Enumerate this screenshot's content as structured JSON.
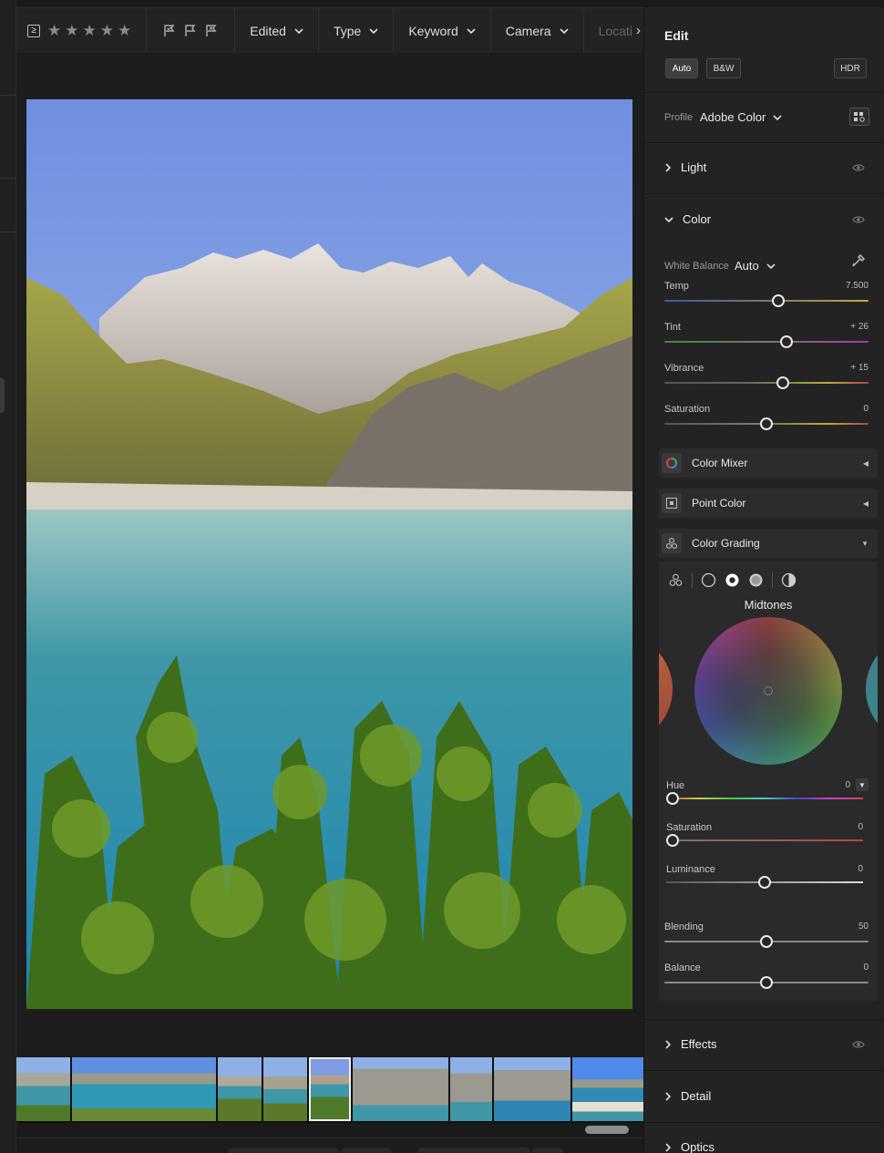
{
  "toolbar": {
    "ge_symbol": "≥",
    "stars": [
      "★",
      "★",
      "★",
      "★",
      "★"
    ],
    "filters": [
      {
        "label": "Edited"
      },
      {
        "label": "Type"
      },
      {
        "label": "Keyword"
      },
      {
        "label": "Camera"
      }
    ],
    "truncated_filter": "Locati",
    "more_arrow": "›"
  },
  "panel": {
    "title": "Edit",
    "auto_label": "Auto",
    "bw_label": "B&W",
    "hdr_label": "HDR",
    "profile_label": "Profile",
    "profile_value": "Adobe Color",
    "sections": {
      "light": "Light",
      "color": "Color",
      "effects": "Effects",
      "detail": "Detail",
      "optics": "Optics"
    },
    "white_balance_label": "White Balance",
    "white_balance_value": "Auto",
    "color_sliders": [
      {
        "label": "Temp",
        "value": "7.500",
        "position": 0.56
      },
      {
        "label": "Tint",
        "value": "+ 26",
        "position": 0.6
      },
      {
        "label": "Vibrance",
        "value": "+ 15",
        "position": 0.58
      },
      {
        "label": "Saturation",
        "value": "0",
        "position": 0.5
      }
    ],
    "color_mixer": "Color Mixer",
    "point_color": "Point Color",
    "color_grading": {
      "title": "Color Grading",
      "wheel_title": "Midtones",
      "sliders": [
        {
          "label": "Hue",
          "value": "0",
          "position": 0.0
        },
        {
          "label": "Saturation",
          "value": "0",
          "position": 0.0
        },
        {
          "label": "Luminance",
          "value": "0",
          "position": 0.5
        }
      ],
      "blending": {
        "label": "Blending",
        "value": "50",
        "position": 0.5
      },
      "balance": {
        "label": "Balance",
        "value": "0",
        "position": 0.5
      }
    }
  },
  "colors": {
    "temp_track": "linear-gradient(90deg,#3d5a9a,#777 50%,#c9a63a)",
    "tint_track": "linear-gradient(90deg,#3c8a3c,#777 50%,#a53ca5)",
    "vib_track": "linear-gradient(90deg,#555 0%,#666 40%,#6b9a3c 60%,#c9a63a 80%,#a54a4a)",
    "sat_track": "linear-gradient(90deg,#555 0%,#777 40%,#6b9a3c 60%,#c9a63a 80%,#a54a4a)"
  }
}
